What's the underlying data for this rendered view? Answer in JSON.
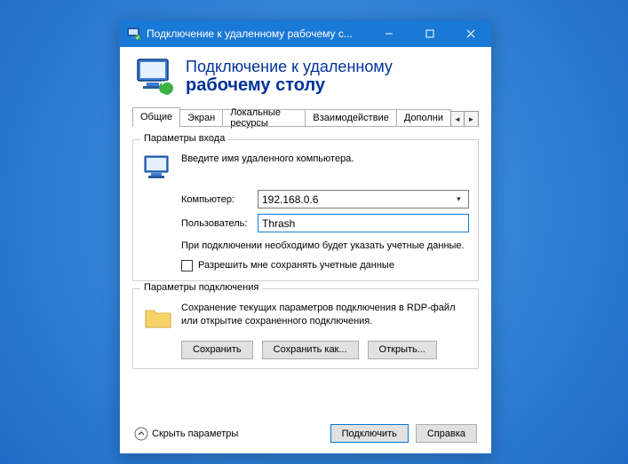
{
  "window": {
    "title": "Подключение к удаленному рабочему с..."
  },
  "header": {
    "line1": "Подключение к удаленному",
    "line2": "рабочему столу"
  },
  "tabs": {
    "items": [
      "Общие",
      "Экран",
      "Локальные ресурсы",
      "Взаимодействие",
      "Дополни"
    ],
    "active_index": 0
  },
  "login_group": {
    "title": "Параметры входа",
    "instruction": "Введите имя удаленного компьютера.",
    "computer_label": "Компьютер:",
    "computer_value": "192.168.0.6",
    "user_label": "Пользователь:",
    "user_value": "Thrash",
    "note": "При подключении необходимо будет указать учетные данные.",
    "checkbox_label": "Разрешить мне сохранять учетные данные"
  },
  "conn_group": {
    "title": "Параметры подключения",
    "text": "Сохранение текущих параметров подключения в RDP-файл или открытие сохраненного подключения.",
    "save": "Сохранить",
    "save_as": "Сохранить как...",
    "open": "Открыть..."
  },
  "footer": {
    "hide_params": "Скрыть параметры",
    "connect": "Подключить",
    "help": "Справка"
  }
}
